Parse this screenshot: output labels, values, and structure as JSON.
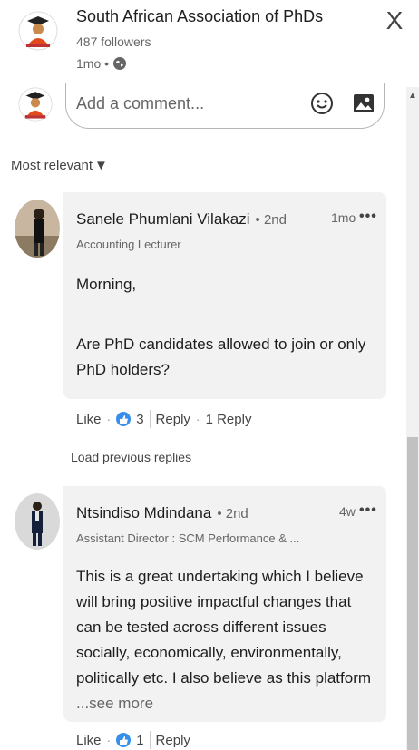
{
  "header": {
    "org_name": "South African Association of PhDs",
    "followers": "487 followers",
    "time": "1mo •",
    "close_symbol": "X"
  },
  "comment_input": {
    "placeholder": "Add a comment..."
  },
  "sort": {
    "label": "Most relevant"
  },
  "comments": [
    {
      "author": "Sanele Phumlani Vilakazi",
      "degree": "• 2nd",
      "headline": "Accounting Lecturer",
      "time": "1mo",
      "menu": "•••",
      "paragraphs": [
        "Morning,",
        "Are PhD candidates allowed to join or only PhD holders?"
      ],
      "like_label": "Like",
      "reaction_count": "3",
      "reply_label": "Reply",
      "replies_label": "1 Reply"
    },
    {
      "author": "Ntsindiso Mdindana",
      "degree": "• 2nd",
      "headline": "Assistant Director : SCM Performance & ...",
      "time": "4w",
      "menu": "•••",
      "text": "This is a great undertaking which I believe will bring positive impactful changes that can be tested across different issues socially, economically, environmentally, politically etc. I also believe as this platform",
      "see_more": "...see more",
      "like_label": "Like",
      "reaction_count": "1",
      "reply_label": "Reply"
    }
  ],
  "load_previous": "Load previous replies",
  "colors": {
    "accent": "#0a66c2",
    "bubble": "#f2f2f2"
  }
}
